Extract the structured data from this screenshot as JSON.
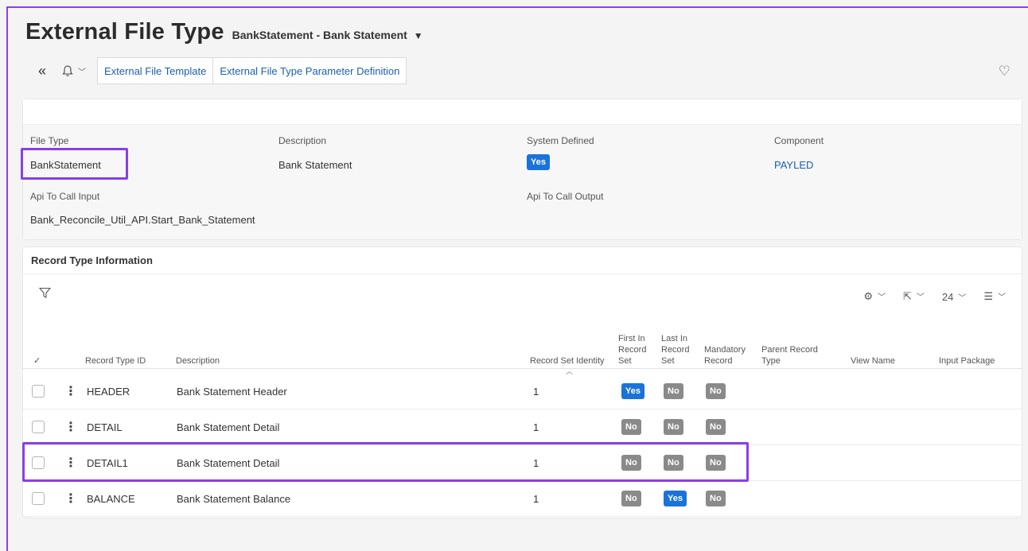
{
  "title": {
    "main": "External File Type",
    "sub": "BankStatement - Bank Statement"
  },
  "toolbar": {
    "tabs": [
      {
        "label": "External File Template"
      },
      {
        "label": "External File Type Parameter Definition"
      }
    ]
  },
  "header": {
    "fields": {
      "file_type": {
        "label": "File Type",
        "value": "BankStatement"
      },
      "description": {
        "label": "Description",
        "value": "Bank Statement"
      },
      "system_defined": {
        "label": "System Defined",
        "value": "Yes"
      },
      "component": {
        "label": "Component",
        "value": "PAYLED"
      },
      "api_input": {
        "label": "Api To Call Input",
        "value": "Bank_Reconcile_Util_API.Start_Bank_Statement"
      },
      "api_output": {
        "label": "Api To Call Output",
        "value": ""
      }
    }
  },
  "record_table": {
    "title": "Record Type Information",
    "page_size": "24",
    "columns": {
      "record_type_id": "Record Type ID",
      "description": "Description",
      "record_set_identity": "Record Set Identity",
      "first_in_set": [
        "First In",
        "Record",
        "Set"
      ],
      "last_in_set": [
        "Last In",
        "Record",
        "Set"
      ],
      "mandatory": [
        "Mandatory",
        "Record"
      ],
      "parent": [
        "Parent Record",
        "Type"
      ],
      "view_name": "View Name",
      "input_package": "Input Package"
    },
    "rows": [
      {
        "id": "HEADER",
        "description": "Bank Statement Header",
        "identity": "1",
        "first": "Yes",
        "last": "No",
        "mandatory": "No"
      },
      {
        "id": "DETAIL",
        "description": "Bank Statement Detail",
        "identity": "1",
        "first": "No",
        "last": "No",
        "mandatory": "No"
      },
      {
        "id": "DETAIL1",
        "description": "Bank Statement Detail",
        "identity": "1",
        "first": "No",
        "last": "No",
        "mandatory": "No"
      },
      {
        "id": "BALANCE",
        "description": "Bank Statement Balance",
        "identity": "1",
        "first": "No",
        "last": "Yes",
        "mandatory": "No"
      }
    ]
  },
  "colors": {
    "accent": "#1a73d9",
    "highlight": "#8a3ee8",
    "badge_no": "#8a8a8a"
  }
}
